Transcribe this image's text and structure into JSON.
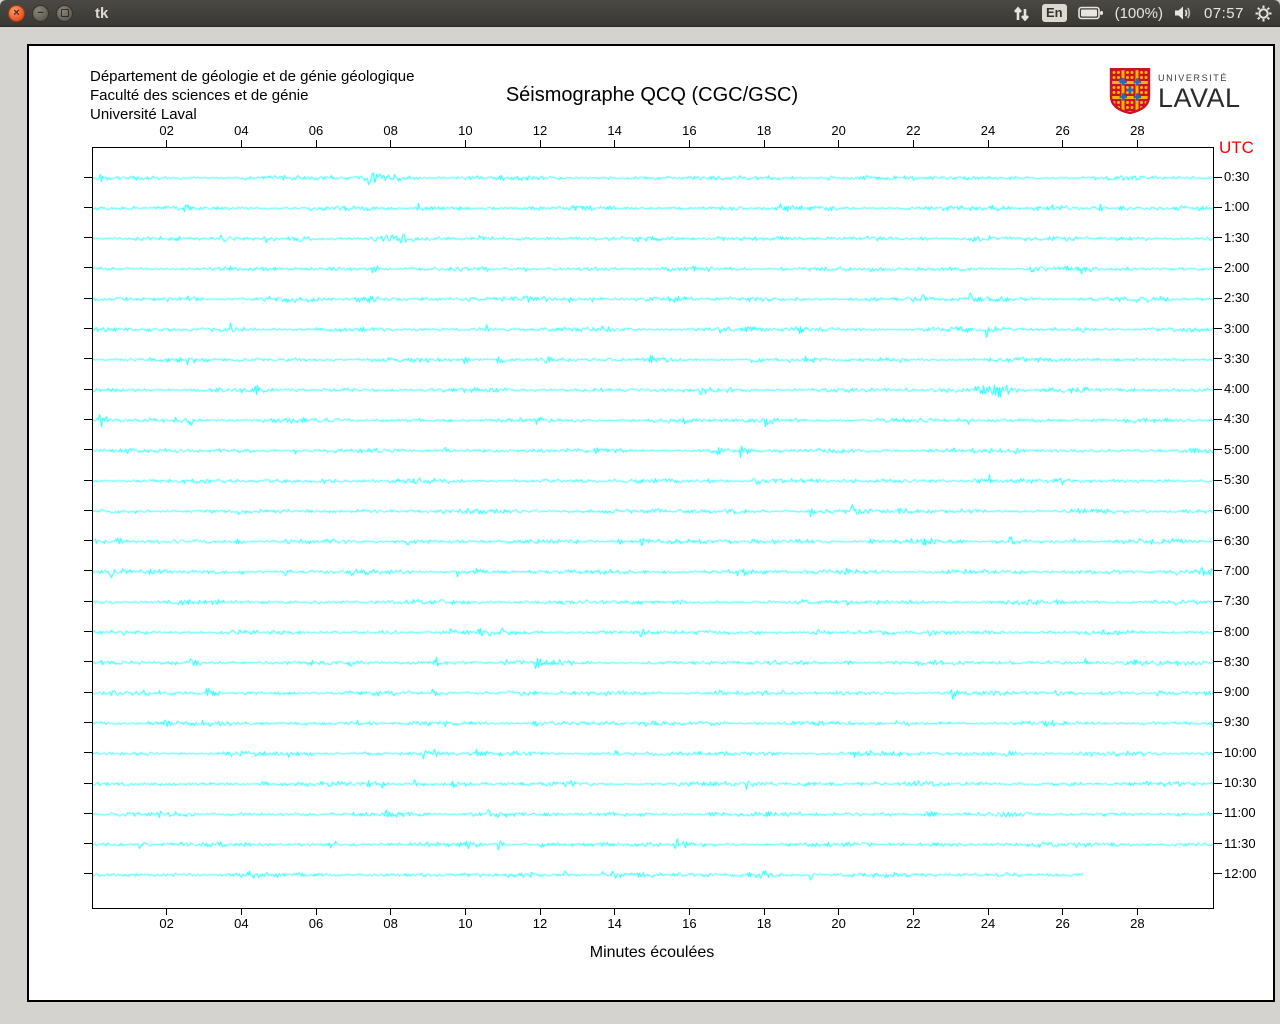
{
  "window": {
    "title": "tk",
    "controls": {
      "close": "×",
      "minimize": "−",
      "maximize": ""
    }
  },
  "tray": {
    "keyboard_layout": "En",
    "battery_percent": "(100%)",
    "clock": "07:57"
  },
  "panel": {
    "org_lines": [
      "Département de géologie et de génie géologique",
      "Faculté des sciences et de génie",
      "Université Laval"
    ],
    "title": "Séismographe QCQ (CGC/GSC)",
    "logo": {
      "line1": "UNIVERSITÉ",
      "line2": "LAVAL"
    },
    "utc_label": "UTC",
    "xlabel": "Minutes écoulées"
  },
  "chart_data": {
    "type": "line",
    "title": "Séismographe QCQ (CGC/GSC)",
    "xlabel": "Minutes écoulées",
    "y_axis_label": "UTC",
    "y_axis_side": "right",
    "x_range_minutes": [
      0,
      30
    ],
    "x_tick_labels": [
      "02",
      "04",
      "06",
      "08",
      "10",
      "12",
      "14",
      "16",
      "18",
      "20",
      "22",
      "24",
      "26",
      "28"
    ],
    "x_tick_minutes": [
      2,
      4,
      6,
      8,
      10,
      12,
      14,
      16,
      18,
      20,
      22,
      24,
      26,
      28
    ],
    "row_duration_minutes": 30,
    "trace_color": "#00ffff",
    "grid": false,
    "rows": [
      {
        "label": "0:30",
        "end_min": 30
      },
      {
        "label": "1:00",
        "end_min": 30
      },
      {
        "label": "1:30",
        "end_min": 30
      },
      {
        "label": "2:00",
        "end_min": 30
      },
      {
        "label": "2:30",
        "end_min": 30
      },
      {
        "label": "3:00",
        "end_min": 30
      },
      {
        "label": "3:30",
        "end_min": 30
      },
      {
        "label": "4:00",
        "end_min": 30
      },
      {
        "label": "4:30",
        "end_min": 30
      },
      {
        "label": "5:00",
        "end_min": 30
      },
      {
        "label": "5:30",
        "end_min": 30
      },
      {
        "label": "6:00",
        "end_min": 30
      },
      {
        "label": "6:30",
        "end_min": 30
      },
      {
        "label": "7:00",
        "end_min": 30
      },
      {
        "label": "7:30",
        "end_min": 30
      },
      {
        "label": "8:00",
        "end_min": 30
      },
      {
        "label": "8:30",
        "end_min": 30
      },
      {
        "label": "9:00",
        "end_min": 30
      },
      {
        "label": "9:30",
        "end_min": 30
      },
      {
        "label": "10:00",
        "end_min": 30
      },
      {
        "label": "10:30",
        "end_min": 30
      },
      {
        "label": "11:00",
        "end_min": 30
      },
      {
        "label": "11:30",
        "end_min": 30
      },
      {
        "label": "12:00",
        "end_min": 26.5
      }
    ],
    "events": [
      {
        "row": 0,
        "min": 7.8,
        "amp": 2.2,
        "dur": 0.5
      },
      {
        "row": 2,
        "min": 5.6,
        "amp": 1.5,
        "dur": 0.3
      },
      {
        "row": 2,
        "min": 8.1,
        "amp": 1.8,
        "dur": 0.4
      },
      {
        "row": 2,
        "min": 10.3,
        "amp": 1.5,
        "dur": 0.3
      },
      {
        "row": 2,
        "min": 23.6,
        "amp": 1.5,
        "dur": 0.3
      },
      {
        "row": 2,
        "min": 26.2,
        "amp": 1.2,
        "dur": 0.3
      },
      {
        "row": 4,
        "min": 7.3,
        "amp": 1.8,
        "dur": 0.3
      },
      {
        "row": 4,
        "min": 15.6,
        "amp": 1.6,
        "dur": 0.3
      },
      {
        "row": 7,
        "min": 24.2,
        "amp": 3.5,
        "dur": 0.6
      },
      {
        "row": 8,
        "min": 0.2,
        "amp": 3.0,
        "dur": 0.15
      },
      {
        "row": 8,
        "min": 2.4,
        "amp": 1.5,
        "dur": 0.2
      },
      {
        "row": 10,
        "min": 24.0,
        "amp": 1.2,
        "dur": 0.3
      },
      {
        "row": 21,
        "min": 10.6,
        "amp": 1.8,
        "dur": 0.4
      },
      {
        "row": 21,
        "min": 22.4,
        "amp": 2.0,
        "dur": 0.15
      },
      {
        "row": 23,
        "min": 4.1,
        "amp": 1.5,
        "dur": 0.3
      },
      {
        "row": 23,
        "min": 18.0,
        "amp": 1.3,
        "dur": 0.3
      }
    ]
  }
}
